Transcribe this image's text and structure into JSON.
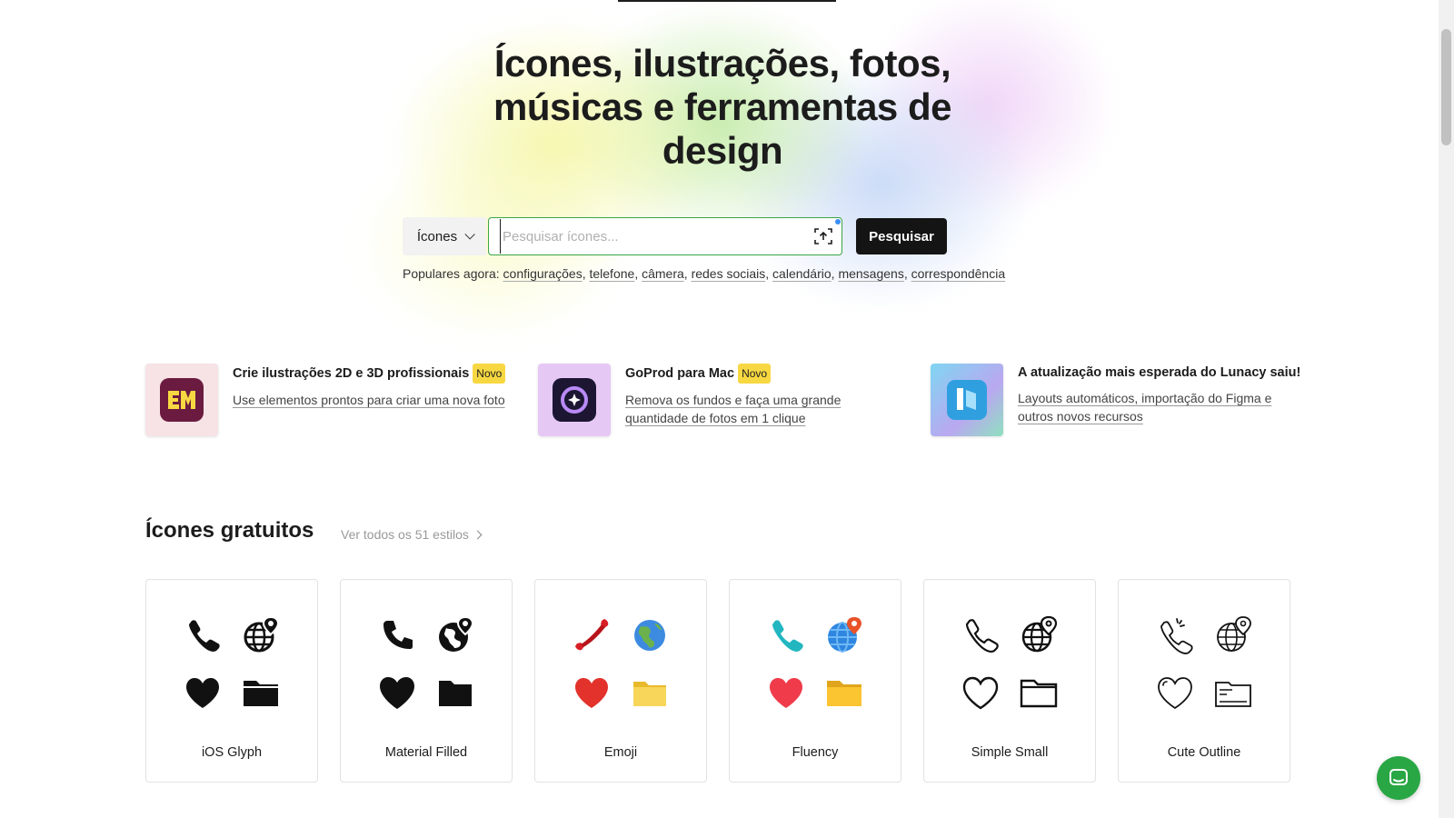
{
  "hero": {
    "title": "Ícones, ilustrações, fotos, músicas e ferramentas de design"
  },
  "search": {
    "type_selected": "Ícones",
    "placeholder": "Pesquisar ícones...",
    "value": "",
    "button_label": "Pesquisar"
  },
  "popular": {
    "label": "Populares agora:",
    "tags": [
      "configurações",
      "telefone",
      "câmera",
      "redes sociais",
      "calendário",
      "mensagens",
      "correspondência"
    ]
  },
  "promos": [
    {
      "title": "Crie ilustrações 2D e 3D profissionais",
      "badge": "Novo",
      "description": "Use elementos prontos para criar uma nova foto",
      "icon": "mega-creator-icon",
      "thumb_bg": "#f7e3e6",
      "icon_bg": "#6b1b3f",
      "icon_color": "#f7d842"
    },
    {
      "title": "GoProd para Mac",
      "badge": "Novo",
      "description": "Remova os fundos e faça uma grande quantidade de fotos em 1 clique",
      "icon": "goprod-icon",
      "thumb_bg": "#e6c8f5",
      "icon_bg": "#1c1633",
      "icon_color": "#b98af5"
    },
    {
      "title": "A atualização mais esperada do Lunacy saiu!",
      "badge": "",
      "description": "Layouts automáticos, importação do Figma e outros novos recursos",
      "icon": "lunacy-icon",
      "thumb_bg": "#9cd7f0",
      "icon_bg": "#2f9fe0",
      "icon_color": "#ffffff"
    }
  ],
  "section": {
    "title": "Ícones gratuitos",
    "see_all": "Ver todos os 51 estilos"
  },
  "styles": [
    {
      "name": "iOS Glyph",
      "icons": [
        "phone-icon",
        "globe-pin-icon",
        "heart-icon",
        "folder-icon"
      ]
    },
    {
      "name": "Material Filled",
      "icons": [
        "phone-icon",
        "globe-pin-icon",
        "heart-icon",
        "folder-icon"
      ]
    },
    {
      "name": "Emoji",
      "icons": [
        "phone-icon",
        "globe-icon",
        "heart-icon",
        "folder-icon"
      ]
    },
    {
      "name": "Fluency",
      "icons": [
        "phone-icon",
        "globe-pin-icon",
        "heart-icon",
        "folder-icon"
      ]
    },
    {
      "name": "Simple Small",
      "icons": [
        "phone-icon",
        "globe-pin-icon",
        "heart-icon",
        "folder-icon"
      ]
    },
    {
      "name": "Cute Outline",
      "icons": [
        "phone-icon",
        "globe-pin-icon",
        "heart-icon",
        "folder-icon"
      ]
    }
  ],
  "colors": {
    "accent_green": "#3aa546",
    "badge_yellow": "#f7d842",
    "chat_green": "#29a744"
  }
}
